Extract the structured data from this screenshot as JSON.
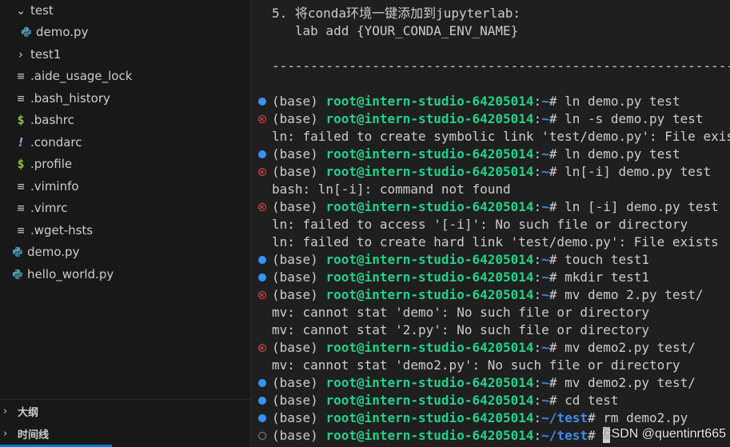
{
  "explorer": {
    "items": [
      {
        "label": "test",
        "icon": "chevron-down-icon"
      },
      {
        "label": "demo.py",
        "icon": "python-file-icon"
      },
      {
        "label": "test1",
        "icon": "chevron-right-icon"
      },
      {
        "label": ".aide_usage_lock",
        "icon": "text-file-icon"
      },
      {
        "label": ".bash_history",
        "icon": "text-file-icon"
      },
      {
        "label": ".bashrc",
        "icon": "shell-file-icon"
      },
      {
        "label": ".condarc",
        "icon": "config-file-icon"
      },
      {
        "label": ".profile",
        "icon": "shell-file-icon"
      },
      {
        "label": ".viminfo",
        "icon": "text-file-icon"
      },
      {
        "label": ".vimrc",
        "icon": "text-file-icon"
      },
      {
        "label": ".wget-hsts",
        "icon": "text-file-icon"
      },
      {
        "label": "demo.py",
        "icon": "python-file-icon"
      },
      {
        "label": "hello_world.py",
        "icon": "python-file-icon"
      }
    ]
  },
  "outline_sections": [
    {
      "label": "大纲",
      "icon": "chevron-right-icon"
    },
    {
      "label": "时间线",
      "icon": "chevron-right-icon"
    }
  ],
  "terminal": {
    "intro_lines": [
      "5. 将conda环境一键添加到jupyterlab:",
      "   lab add {YOUR_CONDA_ENV_NAME}",
      "--------------------------------------------------------------------"
    ],
    "lines": [
      {
        "type": "cmd",
        "status": "ok",
        "env": "(base) ",
        "host": "root@intern-studio-64205014",
        "sep": ":",
        "path": "~",
        "prompt": "# ",
        "cmd": "ln demo.py test"
      },
      {
        "type": "cmd",
        "status": "err",
        "env": "(base) ",
        "host": "root@intern-studio-64205014",
        "sep": ":",
        "path": "~",
        "prompt": "# ",
        "cmd": "ln -s demo.py test"
      },
      {
        "type": "out",
        "text": "ln: failed to create symbolic link 'test/demo.py': File exists"
      },
      {
        "type": "cmd",
        "status": "ok",
        "env": "(base) ",
        "host": "root@intern-studio-64205014",
        "sep": ":",
        "path": "~",
        "prompt": "# ",
        "cmd": "ln demo.py test"
      },
      {
        "type": "cmd",
        "status": "err",
        "env": "(base) ",
        "host": "root@intern-studio-64205014",
        "sep": ":",
        "path": "~",
        "prompt": "# ",
        "cmd": "ln[-i] demo.py test"
      },
      {
        "type": "out",
        "text": "bash: ln[-i]: command not found"
      },
      {
        "type": "cmd",
        "status": "err",
        "env": "(base) ",
        "host": "root@intern-studio-64205014",
        "sep": ":",
        "path": "~",
        "prompt": "# ",
        "cmd": "ln [-i] demo.py test"
      },
      {
        "type": "out",
        "text": "ln: failed to access '[-i]': No such file or directory"
      },
      {
        "type": "out",
        "text": "ln: failed to create hard link 'test/demo.py': File exists"
      },
      {
        "type": "cmd",
        "status": "ok",
        "env": "(base) ",
        "host": "root@intern-studio-64205014",
        "sep": ":",
        "path": "~",
        "prompt": "# ",
        "cmd": "touch test1"
      },
      {
        "type": "cmd",
        "status": "ok",
        "env": "(base) ",
        "host": "root@intern-studio-64205014",
        "sep": ":",
        "path": "~",
        "prompt": "# ",
        "cmd": "mkdir test1"
      },
      {
        "type": "cmd",
        "status": "err",
        "env": "(base) ",
        "host": "root@intern-studio-64205014",
        "sep": ":",
        "path": "~",
        "prompt": "# ",
        "cmd": "mv demo 2.py test/"
      },
      {
        "type": "out",
        "text": "mv: cannot stat 'demo': No such file or directory"
      },
      {
        "type": "out",
        "text": "mv: cannot stat '2.py': No such file or directory"
      },
      {
        "type": "cmd",
        "status": "err",
        "env": "(base) ",
        "host": "root@intern-studio-64205014",
        "sep": ":",
        "path": "~",
        "prompt": "# ",
        "cmd": "mv demo2.py test/"
      },
      {
        "type": "out",
        "text": "mv: cannot stat 'demo2.py': No such file or directory"
      },
      {
        "type": "cmd",
        "status": "ok",
        "env": "(base) ",
        "host": "root@intern-studio-64205014",
        "sep": ":",
        "path": "~",
        "prompt": "# ",
        "cmd": "mv demo2.py test/"
      },
      {
        "type": "cmd",
        "status": "ok",
        "env": "(base) ",
        "host": "root@intern-studio-64205014",
        "sep": ":",
        "path": "~",
        "prompt": "# ",
        "cmd": "cd test"
      },
      {
        "type": "cmd",
        "status": "ok",
        "env": "(base) ",
        "host": "root@intern-studio-64205014",
        "sep": ":",
        "path": "~/test",
        "prompt": "# ",
        "cmd": "rm demo2.py"
      },
      {
        "type": "cmd",
        "status": "idle",
        "env": "(base) ",
        "host": "root@intern-studio-64205014",
        "sep": ":",
        "path": "~/test",
        "prompt": "# ",
        "cmd": ""
      }
    ]
  },
  "watermark": "CSDN @quentinrt665",
  "colors": {
    "prompt_host": "#23d18b",
    "prompt_path": "#3b8eea",
    "status_ok": "#3794ff",
    "status_err": "#f14c4c",
    "status_idle": "#8b8b8b",
    "accent": "#0078d4"
  }
}
